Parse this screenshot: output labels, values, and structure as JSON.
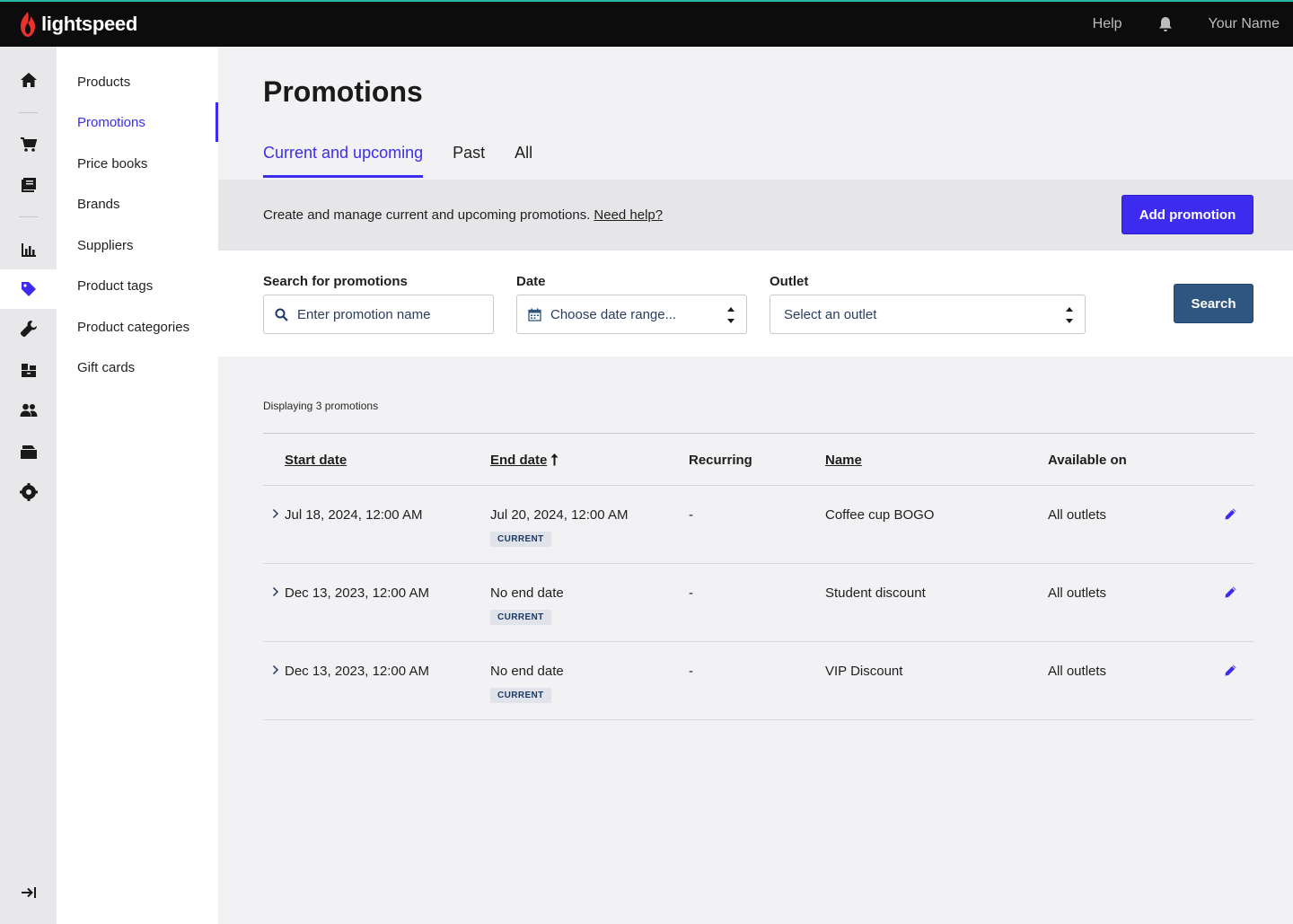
{
  "topbar": {
    "brand": "lightspeed",
    "help": "Help",
    "user": "Your Name",
    "accent": "#2bb7a9",
    "logo_color": "#e8322a"
  },
  "rail": {
    "icons": [
      "home-icon",
      "cart-icon",
      "catalog-icon",
      "chart-icon",
      "tag-icon",
      "wrench-icon",
      "inventory-icon",
      "customers-icon",
      "register-icon",
      "settings-icon",
      "expand-icon"
    ],
    "active": "tag-icon"
  },
  "subnav": {
    "items": [
      "Products",
      "Promotions",
      "Price books",
      "Brands",
      "Suppliers",
      "Product tags",
      "Product categories",
      "Gift cards"
    ],
    "active": "Promotions"
  },
  "page": {
    "title": "Promotions",
    "tabs": [
      "Current and upcoming",
      "Past",
      "All"
    ],
    "active_tab": "Current and upcoming",
    "info_text": "Create and manage current and upcoming promotions.",
    "info_link": "Need help?",
    "add_button": "Add promotion",
    "primary_color": "#3d2cf0"
  },
  "filters": {
    "search_label": "Search for promotions",
    "search_placeholder": "Enter promotion name",
    "date_label": "Date",
    "date_placeholder": "Choose date range...",
    "outlet_label": "Outlet",
    "outlet_placeholder": "Select an outlet",
    "search_button": "Search",
    "search_button_color": "#2f5680"
  },
  "results": {
    "count_text": "Displaying 3 promotions",
    "columns": [
      "Start date",
      "End date",
      "Recurring",
      "Name",
      "Available on"
    ],
    "rows": [
      {
        "start": "Jul 18, 2024, 12:00 AM",
        "end": "Jul 20, 2024, 12:00 AM",
        "status": "CURRENT",
        "recurring": "-",
        "name": "Coffee cup BOGO",
        "available": "All outlets"
      },
      {
        "start": "Dec 13, 2023, 12:00 AM",
        "end": "No end date",
        "status": "CURRENT",
        "recurring": "-",
        "name": "Student discount",
        "available": "All outlets"
      },
      {
        "start": "Dec 13, 2023, 12:00 AM",
        "end": "No end date",
        "status": "CURRENT",
        "recurring": "-",
        "name": "VIP Discount",
        "available": "All outlets"
      }
    ]
  }
}
